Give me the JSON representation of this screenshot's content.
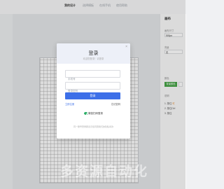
{
  "topbar": {
    "tabs": [
      {
        "label": "我的设计"
      },
      {
        "label": "选择模板"
      },
      {
        "label": "在线手机"
      },
      {
        "label": "使用帮助"
      }
    ]
  },
  "right_panel": {
    "title": "画布",
    "size_label": "画布尺寸",
    "size_value": "500px",
    "bg_label": "背景",
    "bg_select": "无",
    "color_label": "颜色",
    "color_button": "背景颜色",
    "note_title": "说明",
    "note_1_prefix": "1. 按住",
    "note_1_suffix": "可",
    "note_2": "2. 按住Ctrl",
    "note_3": "3. 按住"
  },
  "login": {
    "title": "登录",
    "subtitle": "欢迎您登录！请登录",
    "phone_placeholder": "手机号",
    "password_placeholder": "登录密码",
    "submit": "登录",
    "register": "立即注册",
    "forgot": "忘记密码",
    "wechat": "微信扫码登录",
    "terms": "同一账号登录即表示您同意我们的隐私条款"
  },
  "watermark": "多资源自动化",
  "colors": {
    "primary": "#3d6fe8",
    "wechat_green": "#2bae67",
    "panel_green": "#47a447"
  }
}
